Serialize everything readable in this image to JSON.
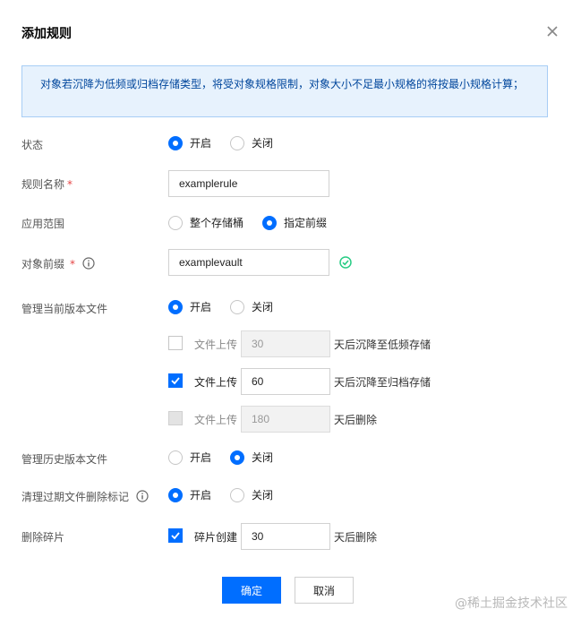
{
  "dialog": {
    "title": "添加规则",
    "notice": "对象若沉降为低频或归档存储类型，将受对象规格限制，对象大小不足最小规格的将按最小规格计算；"
  },
  "status": {
    "label": "状态",
    "on": "开启",
    "off": "关闭",
    "value": "开启"
  },
  "rule_name": {
    "label": "规则名称",
    "required": "*",
    "value": "examplerule"
  },
  "scope": {
    "label": "应用范围",
    "option_bucket": "整个存储桶",
    "option_prefix": "指定前缀",
    "value": "指定前缀"
  },
  "prefix": {
    "label": "对象前缀",
    "required": "*",
    "value": "examplevault"
  },
  "current_version": {
    "label": "管理当前版本文件",
    "on": "开启",
    "off": "关闭",
    "value": "开启",
    "rules": [
      {
        "text": "文件上传",
        "value": "30",
        "suffix": "天后沉降至低频存储",
        "checked": false,
        "disabled": false
      },
      {
        "text": "文件上传",
        "value": "60",
        "suffix": "天后沉降至归档存储",
        "checked": true,
        "disabled": false
      },
      {
        "text": "文件上传",
        "value": "180",
        "suffix": "天后删除",
        "checked": false,
        "disabled": true
      }
    ]
  },
  "history_version": {
    "label": "管理历史版本文件",
    "on": "开启",
    "off": "关闭",
    "value": "关闭"
  },
  "expired_markers": {
    "label": "清理过期文件删除标记",
    "on": "开启",
    "off": "关闭",
    "value": "开启"
  },
  "fragments": {
    "label": "删除碎片",
    "text": "碎片创建",
    "value": "30",
    "suffix": "天后删除",
    "checked": true
  },
  "buttons": {
    "confirm": "确定",
    "cancel": "取消"
  },
  "watermark": "@稀土掘金技术社区",
  "colors": {
    "primary": "#006eff",
    "notice_bg": "#e7f2fd",
    "notice_text": "#00469c",
    "success": "#29cc85",
    "required": "#e54545"
  },
  "icons": {
    "close": "close-icon",
    "info": "info-icon",
    "success": "check-circle-icon",
    "checkbox": "check-icon"
  }
}
